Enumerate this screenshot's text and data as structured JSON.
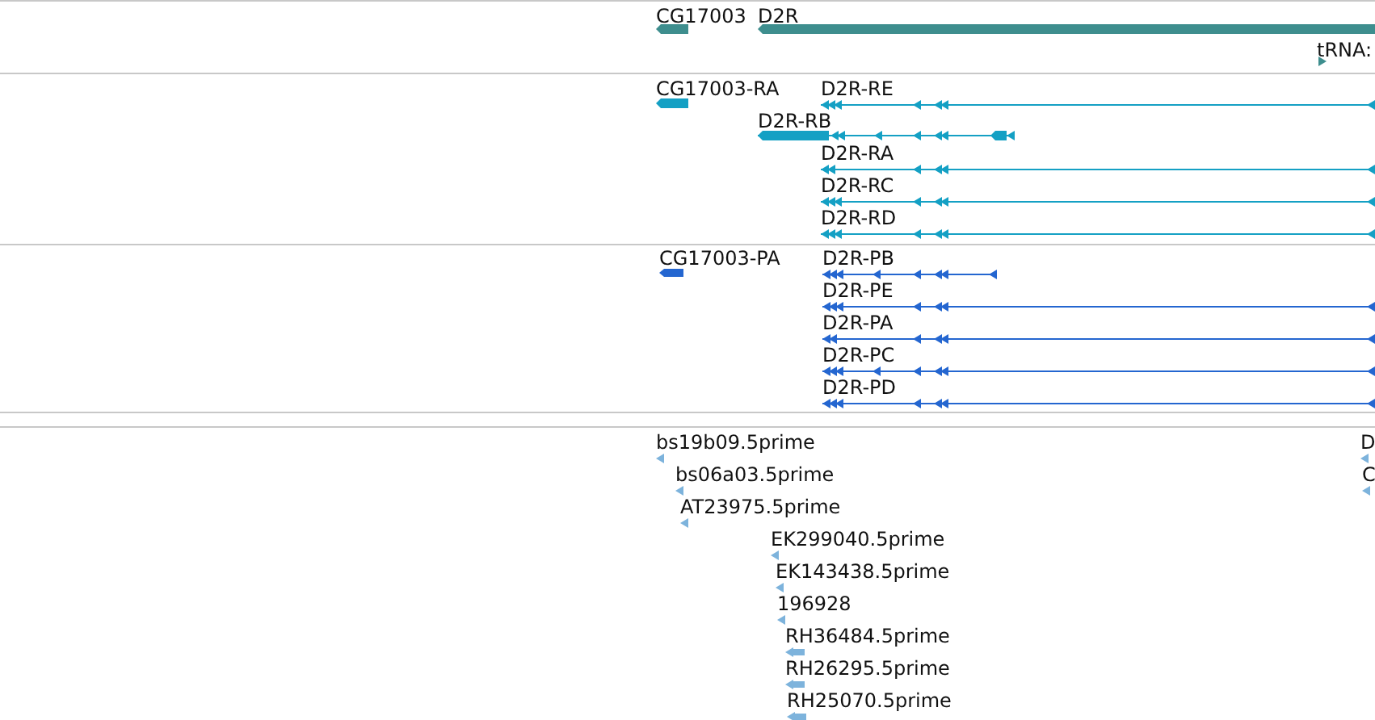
{
  "tracks": [
    {
      "color": "#3e8e8e",
      "features": [
        {
          "kind": "gene",
          "label": "CG17003",
          "forward": false
        },
        {
          "kind": "gene",
          "label": "D2R",
          "forward": false
        },
        {
          "kind": "gene",
          "label": "tRNA:",
          "forward": true
        }
      ]
    },
    {
      "color": "#14a0c4",
      "features": [
        {
          "kind": "transcript",
          "label": "CG17003-RA",
          "forward": false
        },
        {
          "kind": "transcript",
          "label": "D2R-RE",
          "forward": false
        },
        {
          "kind": "transcript",
          "label": "D2R-RB",
          "forward": false
        },
        {
          "kind": "transcript",
          "label": "D2R-RA",
          "forward": false
        },
        {
          "kind": "transcript",
          "label": "D2R-RC",
          "forward": false
        },
        {
          "kind": "transcript",
          "label": "D2R-RD",
          "forward": false
        }
      ]
    },
    {
      "color": "#2466d0",
      "features": [
        {
          "kind": "protein",
          "label": "CG17003-PA",
          "forward": false
        },
        {
          "kind": "protein",
          "label": "D2R-PB",
          "forward": false
        },
        {
          "kind": "protein",
          "label": "D2R-PE",
          "forward": false
        },
        {
          "kind": "protein",
          "label": "D2R-PA",
          "forward": false
        },
        {
          "kind": "protein",
          "label": "D2R-PC",
          "forward": false
        },
        {
          "kind": "protein",
          "label": "D2R-PD",
          "forward": false
        }
      ]
    },
    {
      "color": "#7db3dc",
      "features": [
        {
          "kind": "est",
          "label": "bs19b09.5prime",
          "forward": false
        },
        {
          "kind": "est",
          "label": "bs06a03.5prime",
          "forward": false
        },
        {
          "kind": "est",
          "label": "AT23975.5prime",
          "forward": false
        },
        {
          "kind": "est",
          "label": "EK299040.5prime",
          "forward": false
        },
        {
          "kind": "est",
          "label": "EK143438.5prime",
          "forward": false
        },
        {
          "kind": "est",
          "label": "196928",
          "forward": false
        },
        {
          "kind": "est",
          "label": "RH36484.5prime",
          "forward": false
        },
        {
          "kind": "est",
          "label": "RH26295.5prime",
          "forward": false
        },
        {
          "kind": "est",
          "label": "RH25070.5prime",
          "forward": false
        },
        {
          "kind": "est",
          "label": "D",
          "forward": false
        },
        {
          "kind": "est",
          "label": "C",
          "forward": false
        }
      ]
    }
  ]
}
